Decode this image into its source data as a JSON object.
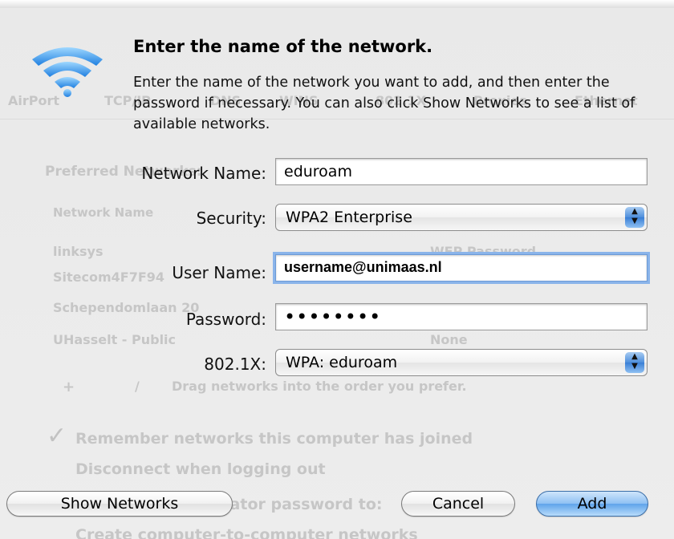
{
  "dialog": {
    "title": "Enter the name of the network.",
    "description": "Enter the name of the network you want to add, and then enter the password if necessary. You can also click Show Networks to see a list of available networks."
  },
  "form": {
    "network_name": {
      "label": "Network Name:",
      "value": "eduroam"
    },
    "security": {
      "label": "Security:",
      "value": "WPA2 Enterprise"
    },
    "user_name": {
      "label": "User Name:",
      "value": "username@unimaas.nl"
    },
    "password": {
      "label": "Password:",
      "value": "••••••••"
    },
    "dot1x": {
      "label": "802.1X:",
      "value": "WPA: eduroam"
    }
  },
  "buttons": {
    "show_networks": "Show Networks",
    "cancel": "Cancel",
    "add": "Add"
  },
  "background": {
    "tabs": [
      "AirPort",
      "TCP/IP",
      "DNS",
      "WINS",
      "802.1X",
      "Proxies",
      "Ethernet"
    ],
    "preferred_label": "Preferred Networks:",
    "column_header": "Network Name",
    "networks": [
      {
        "name": "linksys",
        "security": "WEP Password"
      },
      {
        "name": "Sitecom4F7F94",
        "security": ""
      },
      {
        "name": "Schependomlaan 20",
        "security": ""
      },
      {
        "name": "UHasselt - Public",
        "security": "None"
      }
    ],
    "drag_hint": "Drag networks into the order you prefer.",
    "options": [
      "Remember networks this computer has joined",
      "Disconnect when logging out",
      "Require administrator password to:",
      "Create computer-to-computer networks"
    ]
  },
  "colors": {
    "accent": "#5fa3ea",
    "focus_ring": "#8ab4ea"
  }
}
